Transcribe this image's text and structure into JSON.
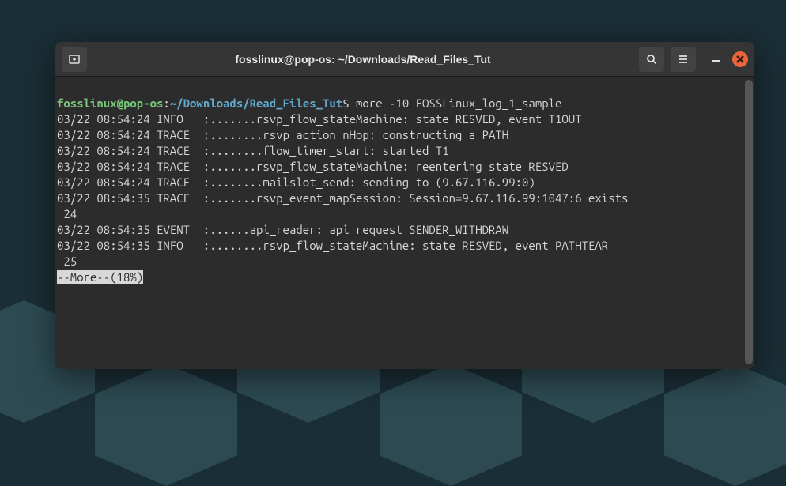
{
  "titlebar": {
    "title": "fosslinux@pop-os: ~/Downloads/Read_Files_Tut"
  },
  "prompt": {
    "user_host": "fosslinux@pop-os",
    "separator": ":",
    "path": "~/Downloads/Read_Files_Tut",
    "dollar": "$ ",
    "command": "more -10 FOSSLinux_log_1_sample"
  },
  "lines": [
    "03/22 08:54:24 INFO   :.......rsvp_flow_stateMachine: state RESVED, event T1OUT",
    "03/22 08:54:24 TRACE  :........rsvp_action_nHop: constructing a PATH",
    "03/22 08:54:24 TRACE  :........flow_timer_start: started T1",
    "03/22 08:54:24 TRACE  :.......rsvp_flow_stateMachine: reentering state RESVED",
    "03/22 08:54:24 TRACE  :........mailslot_send: sending to (9.67.116.99:0)",
    "03/22 08:54:35 TRACE  :.......rsvp_event_mapSession: Session=9.67.116.99:1047:6 exists",
    " 24",
    "03/22 08:54:35 EVENT  :......api_reader: api request SENDER_WITHDRAW",
    "03/22 08:54:35 INFO   :........rsvp_flow_stateMachine: state RESVED, event PATHTEAR",
    " 25"
  ],
  "more_status": "--More--(18%)"
}
